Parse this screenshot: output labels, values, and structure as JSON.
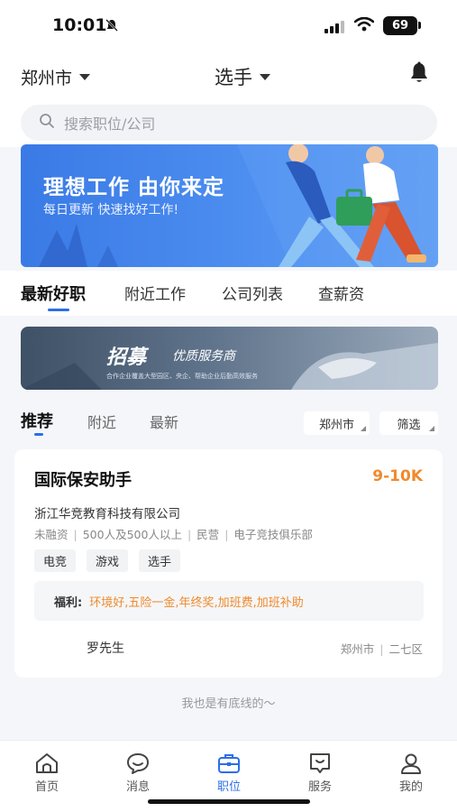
{
  "status": {
    "time": "10:01",
    "battery": "69"
  },
  "header": {
    "city": "郑州市",
    "role": "选手"
  },
  "search": {
    "placeholder": "搜索职位/公司"
  },
  "banner": {
    "title": "理想工作  由你来定",
    "subtitle": "每日更新 快速找好工作!"
  },
  "job_tabs": [
    {
      "label": "最新好职",
      "active": true
    },
    {
      "label": "附近工作",
      "active": false
    },
    {
      "label": "公司列表",
      "active": false
    },
    {
      "label": "查薪资",
      "active": false
    }
  ],
  "promo": {
    "title": "招募",
    "subtitle": "优质服务商",
    "small_text": "合作企业覆盖大型园区、央企、帮助企业后勤高效服务"
  },
  "sub_tabs": [
    {
      "label": "推荐",
      "active": true
    },
    {
      "label": "附近",
      "active": false
    },
    {
      "label": "最新",
      "active": false
    }
  ],
  "filters": {
    "city": "郑州市",
    "filter": "筛选"
  },
  "job": {
    "title": "国际保安助手",
    "salary": "9-10K",
    "company": "浙江华竞教育科技有限公司",
    "meta": [
      "未融资",
      "500人及500人以上",
      "民营",
      "电子竞技俱乐部"
    ],
    "tags": [
      "电竞",
      "游戏",
      "选手"
    ],
    "benefits_label": "福利:",
    "benefits": "环境好,五险一金,年终奖,加班费,加班补助",
    "recruiter": "罗先生",
    "city": "郑州市",
    "district": "二七区"
  },
  "footer_note": "我也是有底线的～",
  "tabbar": [
    {
      "label": "首页",
      "icon": "home-icon",
      "active": false
    },
    {
      "label": "消息",
      "icon": "message-icon",
      "active": false
    },
    {
      "label": "职位",
      "icon": "briefcase-icon",
      "active": true
    },
    {
      "label": "服务",
      "icon": "service-icon",
      "active": false
    },
    {
      "label": "我的",
      "icon": "profile-icon",
      "active": false
    }
  ],
  "colors": {
    "accent": "#2b6ee8",
    "salary": "#f08a2c"
  }
}
